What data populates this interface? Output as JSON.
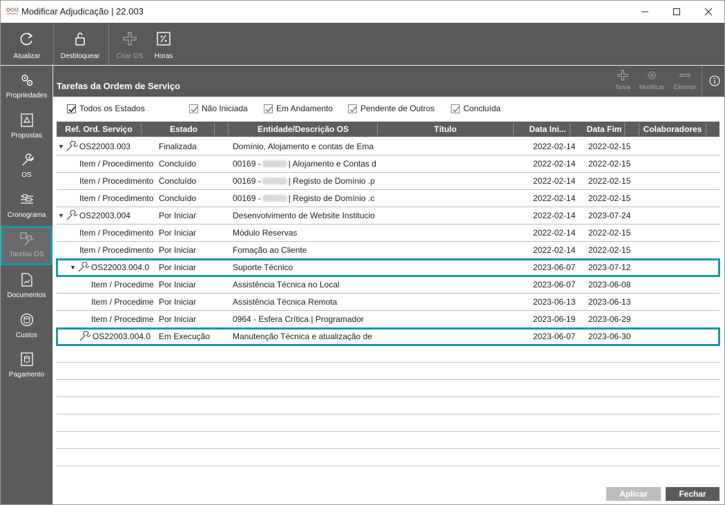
{
  "window": {
    "title": "Modificar Adjudicação | 22.003"
  },
  "toolbar": {
    "refresh_label": "Atualizar",
    "unlock_label": "Desbloquear",
    "create_os_label": "Criar OS",
    "hours_label": "Horas"
  },
  "sidenav": {
    "items": [
      {
        "label": "Propriedades"
      },
      {
        "label": "Propostas"
      },
      {
        "label": "OS"
      },
      {
        "label": "Cronograma"
      },
      {
        "label": "Tarefas OS"
      },
      {
        "label": "Documentos"
      },
      {
        "label": "Custos"
      },
      {
        "label": "Pagamento"
      }
    ]
  },
  "panel": {
    "title": "Tarefas da Ordem de Serviço",
    "new_label": "Nova",
    "edit_label": "Modificar",
    "delete_label": "Eliminar"
  },
  "filters": {
    "all": "Todos os Estados",
    "not_started": "Não Iniciada",
    "in_progress": "Em Andamento",
    "pending": "Pendente de Outros",
    "done": "Concluída"
  },
  "table": {
    "headers": [
      "Ref. Ord. Serviço",
      "Estado",
      "Entidade/Descrição OS",
      "Título",
      "Data Ini...",
      "Data Fim",
      "Colaboradores"
    ],
    "rows": [
      {
        "ref": "OS22003.003",
        "estado": "Finalizada",
        "desc": "Domínio, Alojamento e contas de Ema",
        "ini": "2022-02-14",
        "fim": "2022-02-15"
      },
      {
        "ref": "Item / Procedimento",
        "estado": "Concluído",
        "desc_a": "00169 -",
        "desc_b": "| Alojamento e Contas d",
        "ini": "2022-02-14",
        "fim": "2022-02-15"
      },
      {
        "ref": "Item / Procedimento",
        "estado": "Concluído",
        "desc_a": "00169 -",
        "desc_b": "| Registo de Domínio .p",
        "ini": "2022-02-14",
        "fim": "2022-02-15"
      },
      {
        "ref": "Item / Procedimento",
        "estado": "Concluído",
        "desc_a": "00169 -",
        "desc_b": "| Registo de Domínio .c",
        "ini": "2022-02-14",
        "fim": "2022-02-15"
      },
      {
        "ref": "OS22003.004",
        "estado": "Por Iniciar",
        "desc": "Desenvolvimento de Website Institucio",
        "ini": "2022-02-14",
        "fim": "2023-07-24"
      },
      {
        "ref": "Item / Procedimento",
        "estado": "Por Iniciar",
        "desc": "Módulo Reservas",
        "ini": "2022-02-14",
        "fim": "2022-02-15"
      },
      {
        "ref": "Item / Procedimento",
        "estado": "Por Iniciar",
        "desc": "Fomação ao Cliente",
        "ini": "2022-02-14",
        "fim": "2022-02-15"
      },
      {
        "ref": "OS22003.004.0",
        "estado": "Por Iniciar",
        "desc": "Suporte Técnico",
        "ini": "2023-06-07",
        "fim": "2023-07-12"
      },
      {
        "ref": "Item / Procedime",
        "estado": "Por Iniciar",
        "desc": "Assistência Técnica no Local",
        "ini": "2023-06-07",
        "fim": "2023-06-08"
      },
      {
        "ref": "Item / Procedime",
        "estado": "Por Iniciar",
        "desc": "Assistência Técnica Remota",
        "ini": "2023-06-13",
        "fim": "2023-06-13"
      },
      {
        "ref": "Item / Procedime",
        "estado": "Por Iniciar",
        "desc": "0964 - Esfera Crítica | Programador",
        "ini": "2023-06-19",
        "fim": "2023-06-29"
      },
      {
        "ref": "OS22003.004.0",
        "estado": "Em Execução",
        "desc": "Manutenção Técnica e atualização de",
        "ini": "2023-06-07",
        "fim": "2023-06-30"
      }
    ]
  },
  "footer": {
    "apply_label": "Aplicar",
    "close_label": "Fechar"
  },
  "colors": {
    "toolbar_bg": "#595959",
    "highlight": "#1a98a8",
    "header_bg": "#5c5c5c"
  }
}
